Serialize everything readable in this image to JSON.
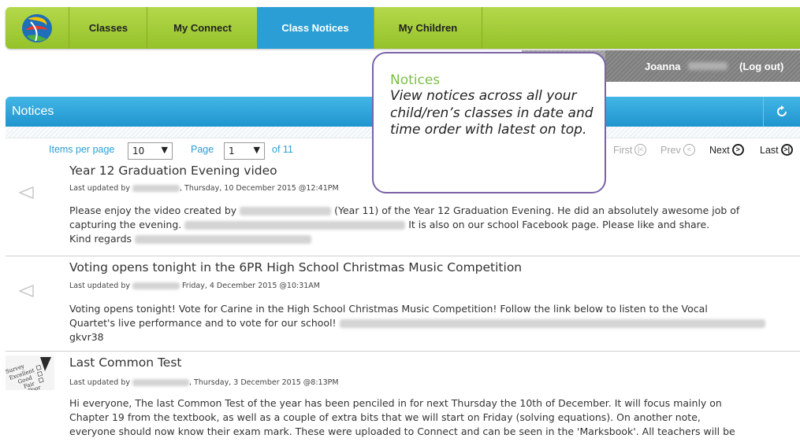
{
  "nav": {
    "logo": "school-logo",
    "tabs": [
      {
        "label": "Classes"
      },
      {
        "label": "My Connect"
      },
      {
        "label": "Class Notices"
      },
      {
        "label": "My Children"
      }
    ],
    "active_tab": "Class Notices"
  },
  "user": {
    "name": "Joanna",
    "logout": "(Log out)"
  },
  "panel": {
    "title": "Notices",
    "refresh_icon": "refresh-icon"
  },
  "pager": {
    "items_label": "Items per page",
    "items_value": "10",
    "page_label": "Page",
    "page_value": "1",
    "of_label": "of 11",
    "first": "First",
    "prev": "Prev",
    "next": "Next",
    "last": "Last"
  },
  "callout": {
    "title": "Notices",
    "text": "View notices across all your child/ren’s classes in date and time order with latest on top."
  },
  "notices": [
    {
      "title": "Year 12 Graduation Evening video",
      "meta_prefix": "Last updated by",
      "meta_date": ", Thursday, 10 December 2015 @12:41PM",
      "body_1": "Please enjoy the video created by",
      "body_2": "(Year 11) of the Year 12 Graduation Evening. He did an absolutely awesome job of",
      "body_3": "capturing the evening.",
      "body_4": "It is also on our school Facebook page. Please like and share.",
      "body_5": "Kind regards",
      "icon": "megaphone-icon"
    },
    {
      "title": "Voting opens tonight in the 6PR High School Christmas Music Competition",
      "meta_prefix": "Last updated by",
      "meta_date": " Friday, 4 December 2015 @10:31AM",
      "body_1": "Voting opens tonight! Vote for Carine in the High School Christmas Music Competition! Follow the link below to listen to the Vocal",
      "body_2": "Quartet's live performance and to vote for our school!",
      "body_3": "gkvr38",
      "icon": "megaphone-icon"
    },
    {
      "title": "Last Common Test",
      "meta_prefix": "Last updated by",
      "meta_date": ", Thursday, 3 December 2015 @8:13PM",
      "body_1": "Hi everyone, The last Common Test of the year has been penciled in for next Thursday the 10th of December. It will focus mainly on",
      "body_2": "Chapter 19 from the textbook, as well as a couple of extra bits that we will start on Friday (solving equations). On another note,",
      "body_3": "everyone should now know their exam mark. These were uploaded to Connect and can be seen in the 'Marksbook'. All teachers will be",
      "survey_words": [
        "Survey",
        "Excellent",
        "Good",
        "Fair",
        "Poor"
      ],
      "icon": "survey-checklist-icon"
    }
  ]
}
